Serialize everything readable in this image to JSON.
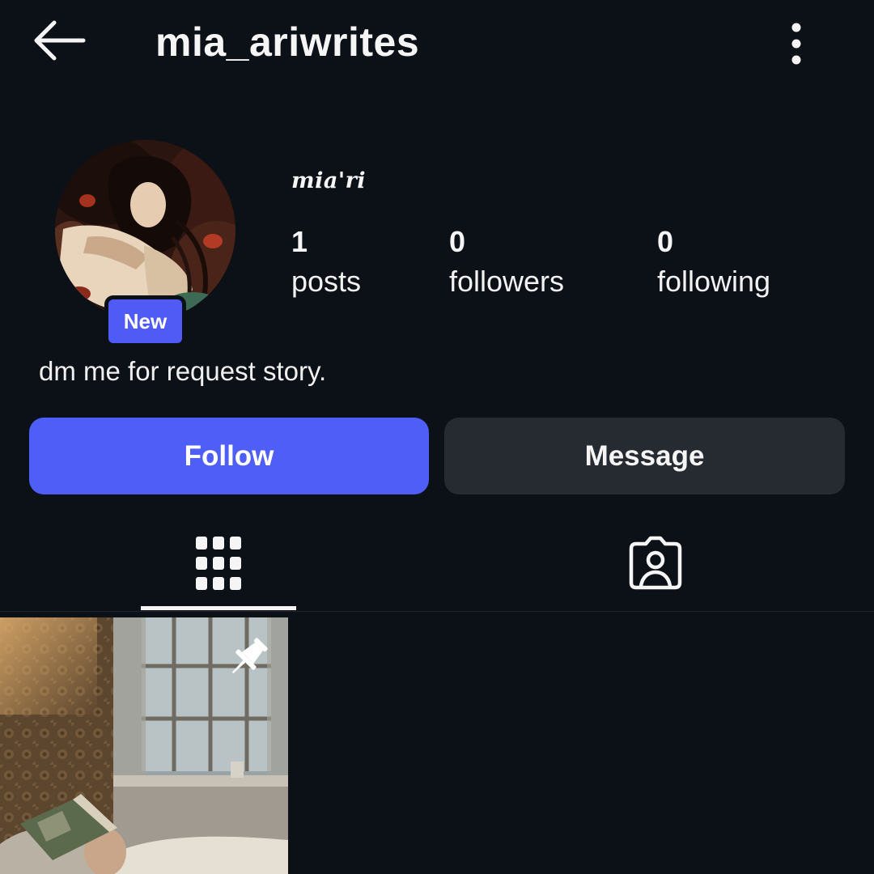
{
  "header": {
    "back_icon": "arrow-left-icon",
    "username": "mia_ariwrites",
    "more_icon": "more-vertical-icon"
  },
  "profile": {
    "avatar_alt": "profile picture",
    "badge": "New",
    "display_name": "mia'ri",
    "stats": [
      {
        "value": "1",
        "label": "posts"
      },
      {
        "value": "0",
        "label": "followers"
      },
      {
        "value": "0",
        "label": "following"
      }
    ],
    "bio": "dm me for request story."
  },
  "actions": {
    "follow_label": "Follow",
    "message_label": "Message"
  },
  "tabs": [
    {
      "icon": "grid-icon",
      "active": true
    },
    {
      "icon": "tagged-person-icon",
      "active": false
    }
  ],
  "posts": [
    {
      "pinned": true,
      "pin_icon": "pin-icon"
    }
  ],
  "colors": {
    "background": "#0c1017",
    "accent": "#4e5ef7",
    "secondary_button": "#262a31",
    "text": "#f5f5f5"
  }
}
